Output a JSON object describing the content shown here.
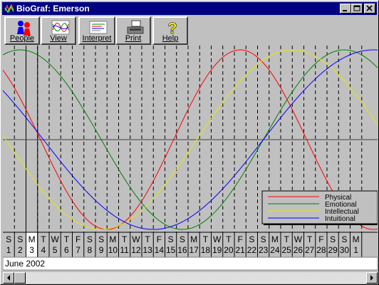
{
  "window": {
    "title": "BioGraf: Emerson"
  },
  "toolbar": {
    "people": "People",
    "view": "View",
    "interpret": "Interpret",
    "print": "Print",
    "help": "Help"
  },
  "chart_data": {
    "type": "line",
    "month_label": "June 2002",
    "days": [
      {
        "dow": "S",
        "day": "1"
      },
      {
        "dow": "S",
        "day": "2"
      },
      {
        "dow": "M",
        "day": "3"
      },
      {
        "dow": "T",
        "day": "4"
      },
      {
        "dow": "W",
        "day": "5"
      },
      {
        "dow": "T",
        "day": "6"
      },
      {
        "dow": "F",
        "day": "7"
      },
      {
        "dow": "S",
        "day": "8"
      },
      {
        "dow": "S",
        "day": "9"
      },
      {
        "dow": "M",
        "day": "10"
      },
      {
        "dow": "T",
        "day": "11"
      },
      {
        "dow": "W",
        "day": "12"
      },
      {
        "dow": "T",
        "day": "13"
      },
      {
        "dow": "F",
        "day": "14"
      },
      {
        "dow": "S",
        "day": "15"
      },
      {
        "dow": "S",
        "day": "16"
      },
      {
        "dow": "M",
        "day": "17"
      },
      {
        "dow": "T",
        "day": "18"
      },
      {
        "dow": "W",
        "day": "19"
      },
      {
        "dow": "T",
        "day": "20"
      },
      {
        "dow": "F",
        "day": "21"
      },
      {
        "dow": "S",
        "day": "22"
      },
      {
        "dow": "S",
        "day": "23"
      },
      {
        "dow": "M",
        "day": "24"
      },
      {
        "dow": "T",
        "day": "25"
      },
      {
        "dow": "W",
        "day": "26"
      },
      {
        "dow": "T",
        "day": "27"
      },
      {
        "dow": "F",
        "day": "28"
      },
      {
        "dow": "S",
        "day": "29"
      },
      {
        "dow": "S",
        "day": "30"
      },
      {
        "dow": "M",
        "day": "1"
      }
    ],
    "ylim": [
      -1,
      1
    ],
    "grid": true,
    "legend_position": "bottom-right",
    "selected_day_index": 2,
    "series": [
      {
        "name": "Physical",
        "color": "#ff0000",
        "period": 23,
        "peak_day": 21
      },
      {
        "name": "Emotional",
        "color": "#008000",
        "period": 28,
        "peak_day": 2
      },
      {
        "name": "Intellectual",
        "color": "#e6e600",
        "period": 33,
        "peak_day": 25.5
      },
      {
        "name": "Intuitional",
        "color": "#0000ff",
        "period": 38,
        "peak_day": 32.5
      }
    ]
  }
}
